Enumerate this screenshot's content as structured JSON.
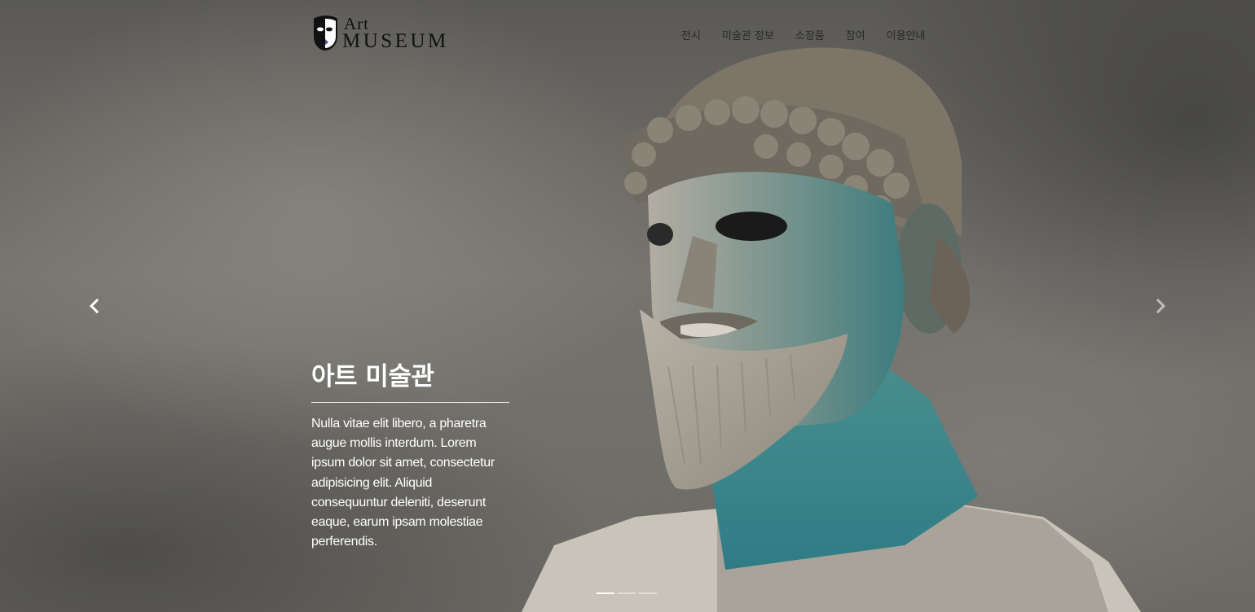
{
  "header": {
    "logo": {
      "line1": "Art",
      "line2": "Museum"
    },
    "nav": [
      {
        "label": "전시"
      },
      {
        "label": "미술관 정보"
      },
      {
        "label": "소장품"
      },
      {
        "label": "참여"
      },
      {
        "label": "이용안내"
      }
    ]
  },
  "carousel": {
    "prev_icon": "chevron-left-icon",
    "next_icon": "chevron-right-icon",
    "slide_count": 3,
    "active_slide": 1,
    "caption": {
      "title": "아트 미술관",
      "body": "Nulla vitae elit libero, a pharetra augue mollis interdum. Lorem ipsum dolor sit amet, consectetur adipisicing elit. Aliquid consequuntur deleniti, deserunt eaque, earum ipsam molestiae perferendis."
    }
  },
  "colors": {
    "nav_text": "#2a2a2a",
    "caption_text": "#ffffff",
    "bronze_patina": "#3f8a8c"
  }
}
